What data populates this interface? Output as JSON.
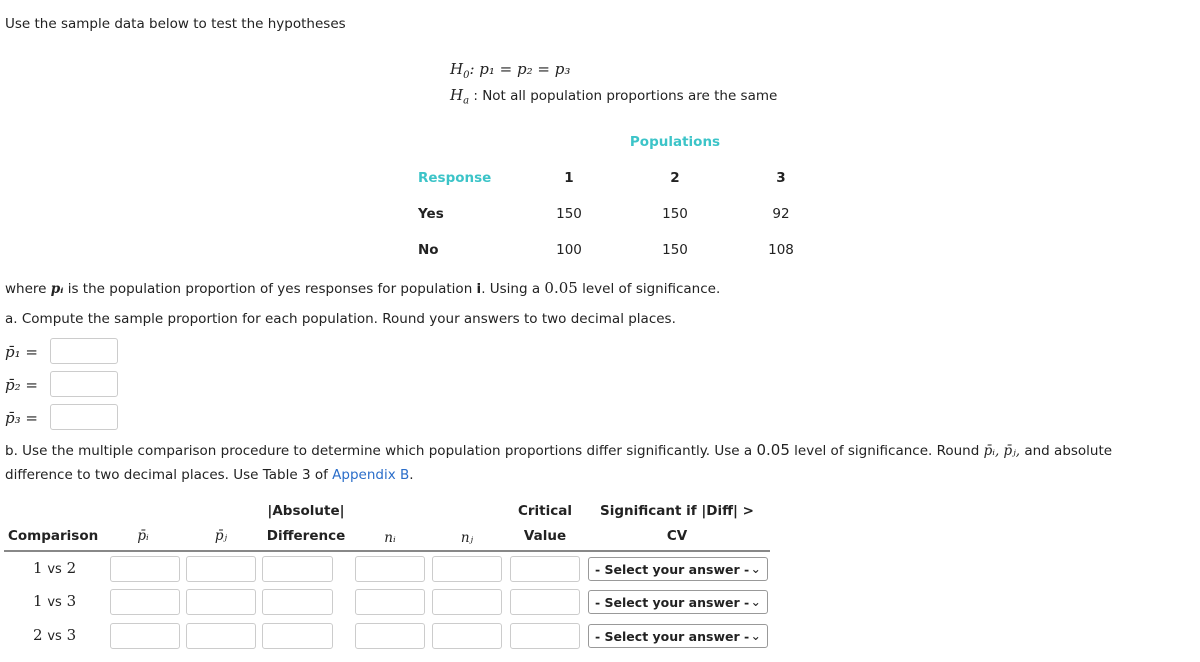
{
  "intro": "Use the sample data below to test the hypotheses",
  "h0_label": "H",
  "h0_sub": "0",
  "h0_expr": ": p₁ = p₂ = p₃",
  "ha_label": "H",
  "ha_sub": "a",
  "ha_text": ": Not all population proportions are the same",
  "pop_table": {
    "title": "Populations",
    "response_label": "Response",
    "columns": [
      "1",
      "2",
      "3"
    ],
    "rows": [
      {
        "label": "Yes",
        "values": [
          "150",
          "150",
          "92"
        ]
      },
      {
        "label": "No",
        "values": [
          "100",
          "150",
          "108"
        ]
      }
    ]
  },
  "where_text": {
    "pre": "where ",
    "var": "pᵢ",
    "mid": " is the population proportion of yes responses for population ",
    "i": "i",
    "mid2": ". Using a ",
    "alpha": "0.05",
    "post": " level of significance."
  },
  "part_a": "a. Compute the sample proportion for each population. Round your answers to two decimal places.",
  "prop_labels": [
    "p̄₁ =",
    "p̄₂ =",
    "p̄₃ ="
  ],
  "part_b": {
    "line1_pre": "b. Use the multiple comparison procedure to determine which population proportions differ significantly. Use a ",
    "alpha": "0.05",
    "line1_post": " level of significance. Round ",
    "vars": "p̄ᵢ, p̄ⱼ,",
    "line1_end": " and absolute",
    "line2_pre": "difference to two decimal places. Use Table 3 of ",
    "link": "Appendix B",
    "line2_post": "."
  },
  "comp_table": {
    "headers": {
      "comparison": "Comparison",
      "pi": "p̄ᵢ",
      "pj": "p̄ⱼ",
      "absdiff_1": "|Absolute|",
      "absdiff_2": "Difference",
      "ni": "nᵢ",
      "nj": "nⱼ",
      "cv_1": "Critical",
      "cv_2": "Value",
      "sig_1": "Significant if |Diff| >",
      "sig_2": "CV"
    },
    "rows": [
      {
        "a": "1",
        "b": "2"
      },
      {
        "a": "1",
        "b": "3"
      },
      {
        "a": "2",
        "b": "3"
      }
    ],
    "vs": "vs",
    "select_placeholder": "- Select your answer -"
  },
  "colors": {
    "teal": "#3cc4c8",
    "link": "#2a6dc9"
  }
}
